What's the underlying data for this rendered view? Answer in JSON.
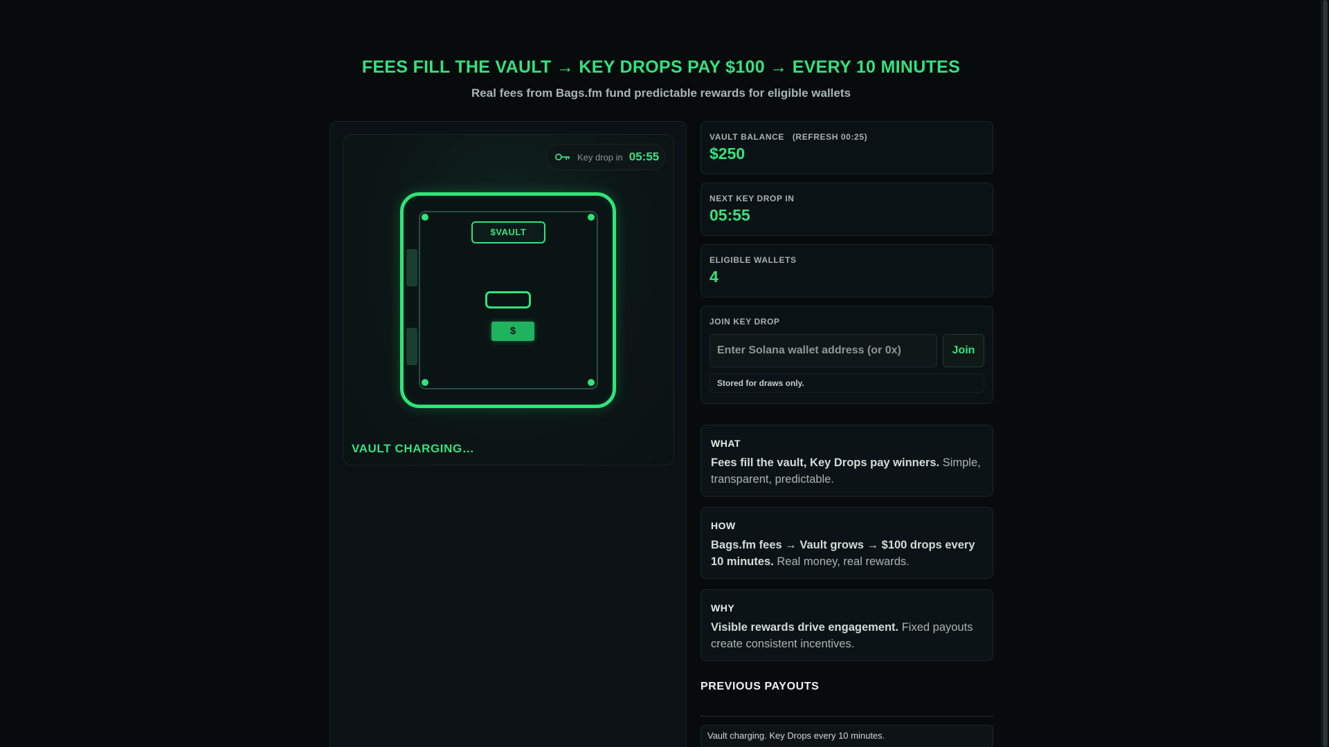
{
  "header": {
    "headline": "FEES FILL THE VAULT → KEY DROPS PAY $100 → EVERY 10 MINUTES",
    "subhead": "Real fees from Bags.fm fund predictable rewards for eligible wallets"
  },
  "vault": {
    "timer_label": "Key drop in",
    "timer_value": "05:55",
    "plate_label": "$VAULT",
    "cash_label": "$",
    "status": "VAULT CHARGING…"
  },
  "stats": {
    "balance_label": "VAULT BALANCE",
    "balance_refresh": "(REFRESH 00:25)",
    "balance_value": "$250",
    "next_label": "NEXT KEY DROP IN",
    "next_value": "05:55",
    "wallets_label": "ELIGIBLE WALLETS",
    "wallets_value": "4"
  },
  "join": {
    "label": "JOIN KEY DROP",
    "placeholder": "Enter Solana wallet address (or 0x)",
    "value": "",
    "button": "Join",
    "note": "Stored for draws only."
  },
  "info": {
    "what_title": "WHAT",
    "what_bold": "Fees fill the vault, Key Drops pay winners.",
    "what_rest": " Simple, transparent, predictable.",
    "how_title": "HOW",
    "how_bold": "Bags.fm fees → Vault grows → $100 drops every 10 minutes.",
    "how_rest": " Real money, real rewards.",
    "why_title": "WHY",
    "why_bold": "Visible rewards drive engagement.",
    "why_rest": " Fixed payouts create consistent incentives."
  },
  "payouts": {
    "title": "PREVIOUS PAYOUTS",
    "empty_message": "Vault charging. Key Drops every 10 minutes."
  },
  "colors": {
    "accent": "#34e27f",
    "background": "#070b0c",
    "card": "#0b1215"
  }
}
